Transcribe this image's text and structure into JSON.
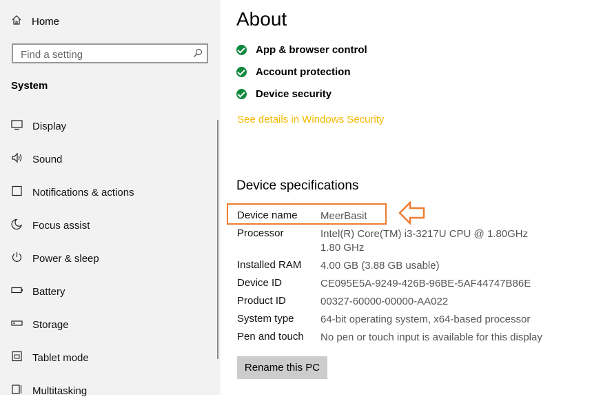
{
  "sidebar": {
    "home_label": "Home",
    "search_placeholder": "Find a setting",
    "section_title": "System",
    "items": [
      {
        "label": "Display",
        "icon": "display-icon"
      },
      {
        "label": "Sound",
        "icon": "sound-icon"
      },
      {
        "label": "Notifications & actions",
        "icon": "notifications-icon"
      },
      {
        "label": "Focus assist",
        "icon": "moon-icon"
      },
      {
        "label": "Power & sleep",
        "icon": "power-icon"
      },
      {
        "label": "Battery",
        "icon": "battery-icon"
      },
      {
        "label": "Storage",
        "icon": "storage-icon"
      },
      {
        "label": "Tablet mode",
        "icon": "tablet-icon"
      },
      {
        "label": "Multitasking",
        "icon": "multitasking-icon"
      }
    ]
  },
  "main": {
    "title": "About",
    "security_items": [
      "App & browser control",
      "Account protection",
      "Device security"
    ],
    "security_link": "See details in Windows Security",
    "specs_title": "Device specifications",
    "specs": [
      {
        "label": "Device name",
        "value": "MeerBasit"
      },
      {
        "label": "Processor",
        "value": "Intel(R) Core(TM) i3-3217U CPU @ 1.80GHz   1.80 GHz"
      },
      {
        "label": "Installed RAM",
        "value": "4.00 GB (3.88 GB usable)"
      },
      {
        "label": "Device ID",
        "value": "CE095E5A-9249-426B-96BE-5AF44747B86E"
      },
      {
        "label": "Product ID",
        "value": "00327-60000-00000-AA022"
      },
      {
        "label": "System type",
        "value": "64-bit operating system, x64-based processor"
      },
      {
        "label": "Pen and touch",
        "value": "No pen or touch input is available for this display"
      }
    ],
    "rename_button": "Rename this PC"
  },
  "colors": {
    "sidebar_bg": "#f2f2f2",
    "check_green": "#10893e",
    "link_yellow": "#f5b800",
    "highlight_orange": "#ed7d31",
    "button_gray": "#cccccc"
  }
}
